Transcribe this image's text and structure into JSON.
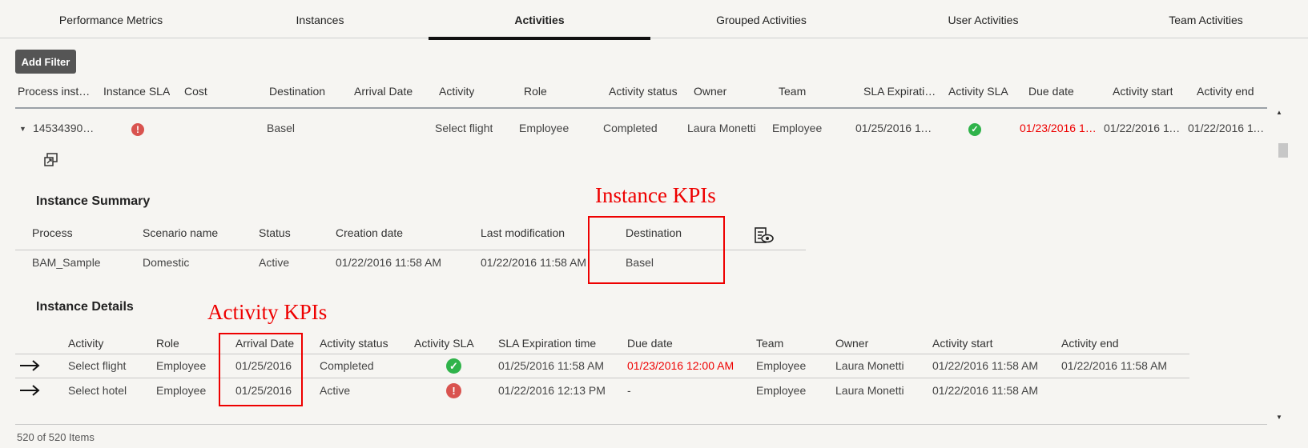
{
  "tabs": [
    "Performance Metrics",
    "Instances",
    "Activities",
    "Grouped Activities",
    "User Activities",
    "Team Activities"
  ],
  "toolbar": {
    "add_filter": "Add Filter"
  },
  "main_columns": [
    "Process inst…▼",
    "Instance SLA",
    "Cost",
    "Destination",
    "Arrival Date",
    "Activity",
    "Role",
    "Activity status",
    "Owner",
    "Team",
    "SLA Expiratio…",
    "Activity SLA",
    "Due date",
    "Activity start",
    "Activity end"
  ],
  "main_row": {
    "process_instance": "145343906…",
    "instance_sla": "!",
    "destination": "Basel",
    "activity": "Select flight",
    "role": "Employee",
    "activity_status": "Completed",
    "owner": "Laura Monetti",
    "team": "Employee",
    "sla_expiration": "01/25/2016 11…",
    "activity_sla": "✓",
    "due_date": "01/23/2016 12…",
    "activity_start": "01/22/2016 11…",
    "activity_end": "01/22/2016 11…"
  },
  "instance_summary": {
    "title": "Instance Summary",
    "columns": [
      "Process",
      "Scenario name",
      "Status",
      "Creation date",
      "Last modification",
      "Destination"
    ],
    "values": [
      "BAM_Sample",
      "Domestic",
      "Active",
      "01/22/2016 11:58 AM",
      "01/22/2016 11:58 AM",
      "Basel"
    ]
  },
  "instance_details": {
    "title": "Instance Details",
    "columns": [
      "Activity",
      "Role",
      "Arrival Date",
      "Activity status",
      "Activity SLA",
      "SLA Expiration time",
      "Due date",
      "Team",
      "Owner",
      "Activity start",
      "Activity end"
    ],
    "rows": [
      [
        "Select flight",
        "Employee",
        "01/25/2016",
        "Completed",
        "✓",
        "01/25/2016 11:58 AM",
        "01/23/2016 12:00 AM",
        "Employee",
        "Laura Monetti",
        "01/22/2016 11:58 AM",
        "01/22/2016 11:58 AM"
      ],
      [
        "Select hotel",
        "Employee",
        "01/25/2016",
        "Active",
        "!",
        "01/22/2016 12:13 PM",
        "-",
        "Employee",
        "Laura Monetti",
        "01/22/2016 11:58 AM",
        ""
      ]
    ]
  },
  "annotations": {
    "instance_kpis": "Instance KPIs",
    "activity_kpis": "Activity KPIs"
  },
  "footer": "520 of 520 Items",
  "colors": {
    "annotation": "#e00000",
    "ok": "#2fb34a",
    "error": "#d9534f",
    "overdue": "#e00000"
  },
  "icons": [
    "expand-arrow-icon",
    "open-window-icon",
    "view-details-icon",
    "navigate-arrow-icon",
    "error-icon",
    "check-icon"
  ]
}
